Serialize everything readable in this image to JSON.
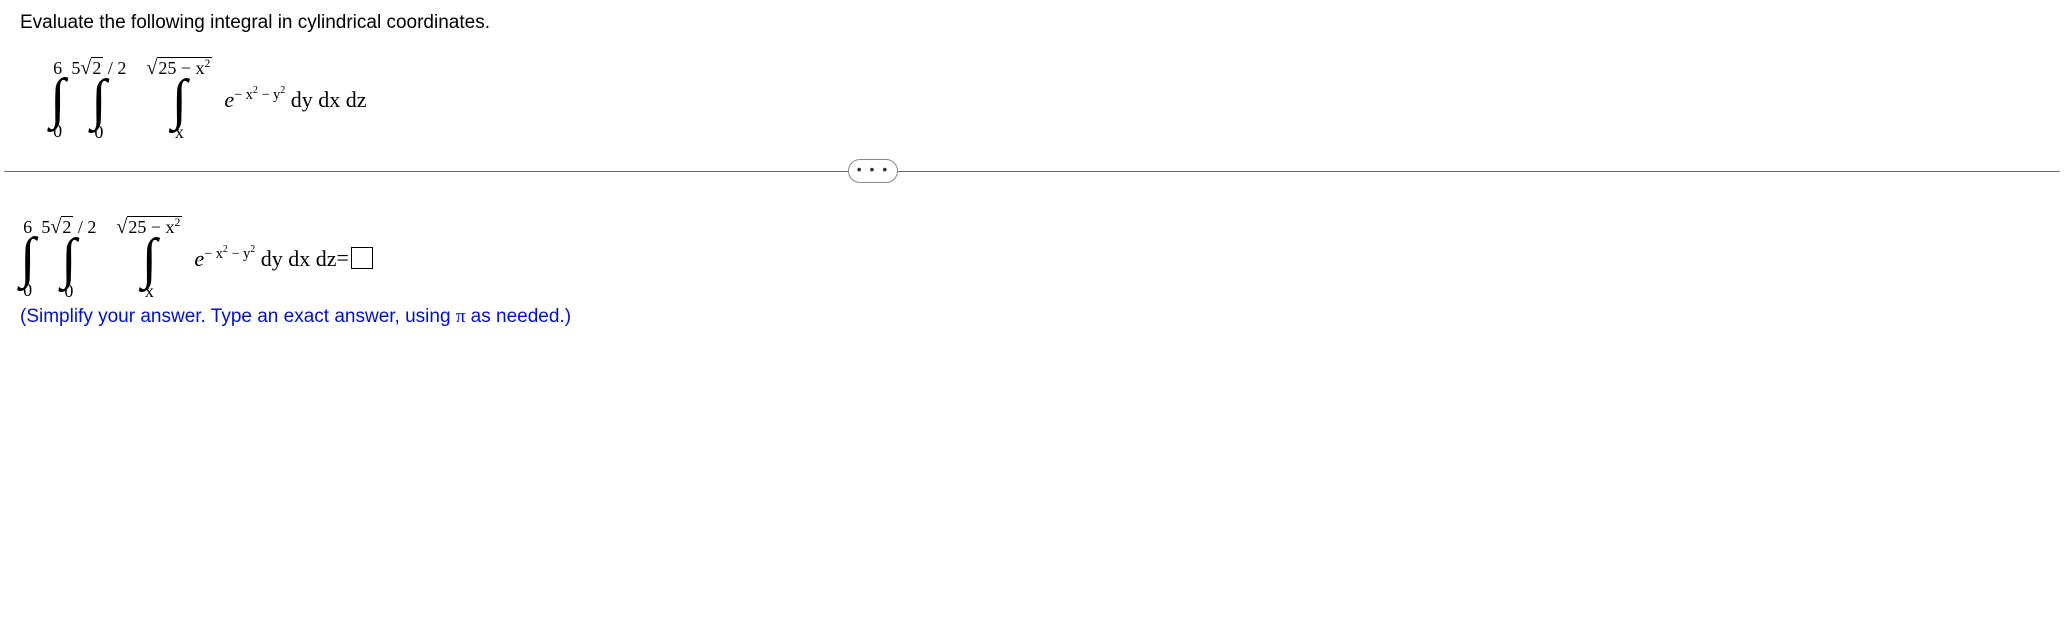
{
  "question": "Evaluate the following integral in cylindrical coordinates.",
  "integral": {
    "z_lower": "0",
    "z_upper": "6",
    "x_lower": "0",
    "x_upper_coeff": "5",
    "x_upper_sqrt": "2",
    "x_upper_div": "/ 2",
    "y_lower": "x",
    "y_upper_sqrt": "25 − x",
    "integrand_e": "e",
    "integrand_exp_left": "− x",
    "integrand_exp_mid": " − y",
    "integrand_tail": "dy dx dz"
  },
  "answer": {
    "equals": " = "
  },
  "hint_parts": {
    "a": "(Simplify your answer. Type an exact answer, using ",
    "b": "π",
    "c": " as needed.)"
  },
  "pill": "• • •"
}
